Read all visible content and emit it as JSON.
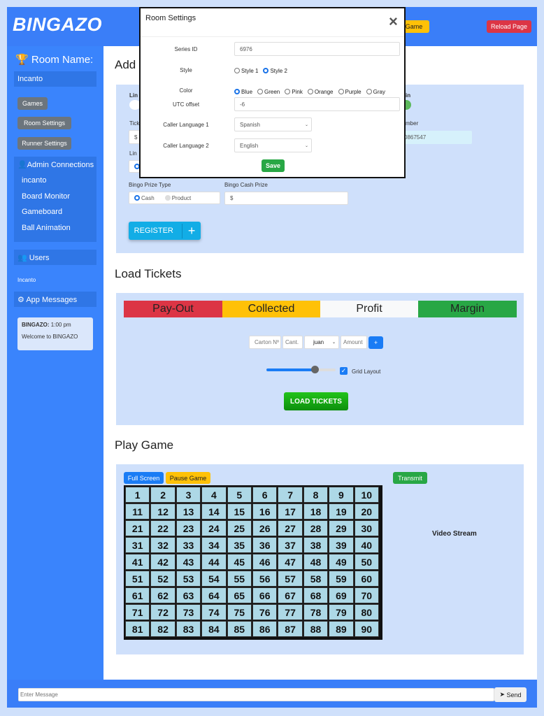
{
  "header": {
    "logo": "BINGAZO",
    "game_button": "Game",
    "reload_button": "Reload Page"
  },
  "sidebar": {
    "room_name_label": "Room Name:",
    "room_name": "Incanto",
    "buttons": [
      "Games",
      "Room Settings",
      "Runner Settings"
    ],
    "admin_title": "Admin Connections",
    "admin_items": [
      "incanto",
      "Board Monitor",
      "Gameboard",
      "Ball Animation"
    ],
    "users_title": "Users",
    "users": [
      "Incanto"
    ],
    "messages_title": "App Messages",
    "message": {
      "sender": "BINGAZO:",
      "time": "1:00 pm",
      "text": "Welcome to BINGAZO"
    }
  },
  "register": {
    "title_fragment": "Add",
    "label_fragment_1": "Lin",
    "label_fragment_2": "in",
    "label_fragment_3": "Tick",
    "label_fragment_4": "mber",
    "label_fragment_5": "Lin",
    "ticket_prefix": "$",
    "number_value_fragment": "0867547",
    "bingo_prize_type_label": "Bingo Prize Type",
    "prize_types": [
      "Cash",
      "Product"
    ],
    "bingo_cash_prize_label": "Bingo Cash Prize",
    "cash_prefix": "$",
    "register_button": "REGISTER"
  },
  "load_tickets": {
    "title": "Load Tickets",
    "stats": [
      "Pay-Out",
      "Collected",
      "Profit",
      "Margin"
    ],
    "carton_placeholder": "Carton Nº",
    "cant_placeholder": "Cant.",
    "runner_value": "juan",
    "amount_placeholder": "Amount",
    "add_button": "+",
    "slider_value_percent": 70,
    "grid_layout_label": "Grid Layout",
    "grid_layout_checked": true,
    "load_button": "LOAD TICKETS"
  },
  "play_game": {
    "title": "Play Game",
    "full_screen_button": "Full Screen",
    "pause_button": "Pause Game",
    "transmit_button": "Transmit",
    "video_label": "Video Stream",
    "numbers": [
      1,
      2,
      3,
      4,
      5,
      6,
      7,
      8,
      9,
      10,
      11,
      12,
      13,
      14,
      15,
      16,
      17,
      18,
      19,
      20,
      21,
      22,
      23,
      24,
      25,
      26,
      27,
      28,
      29,
      30,
      31,
      32,
      33,
      34,
      35,
      36,
      37,
      38,
      39,
      40,
      41,
      42,
      43,
      44,
      45,
      46,
      47,
      48,
      49,
      50,
      51,
      52,
      53,
      54,
      55,
      56,
      57,
      58,
      59,
      60,
      61,
      62,
      63,
      64,
      65,
      66,
      67,
      68,
      69,
      70,
      71,
      72,
      73,
      74,
      75,
      76,
      77,
      78,
      79,
      80,
      81,
      82,
      83,
      84,
      85,
      86,
      87,
      88,
      89,
      90
    ]
  },
  "footer": {
    "message_placeholder": "Enter Message",
    "send_button": "Send"
  },
  "modal": {
    "title": "Room Settings",
    "close": "×",
    "series_id_label": "Series ID",
    "series_id": "6976",
    "style_label": "Style",
    "styles": [
      "Style 1",
      "Style 2"
    ],
    "selected_style": "Style 2",
    "color_label": "Color",
    "colors": [
      "Blue",
      "Green",
      "Pink",
      "Orange",
      "Purple",
      "Gray"
    ],
    "selected_color": "Blue",
    "utc_label": "UTC offset",
    "utc_value": "-6",
    "lang1_label": "Caller Language 1",
    "lang1_value": "Spanish",
    "lang2_label": "Caller Language 2",
    "lang2_value": "English",
    "save_button": "Save"
  },
  "colors": {
    "primary": "#3a7ef8",
    "payout": "#dc3545",
    "collected": "#ffc107",
    "profit": "#f8f9fa",
    "margin": "#28a745",
    "cell": "#add8e6"
  }
}
